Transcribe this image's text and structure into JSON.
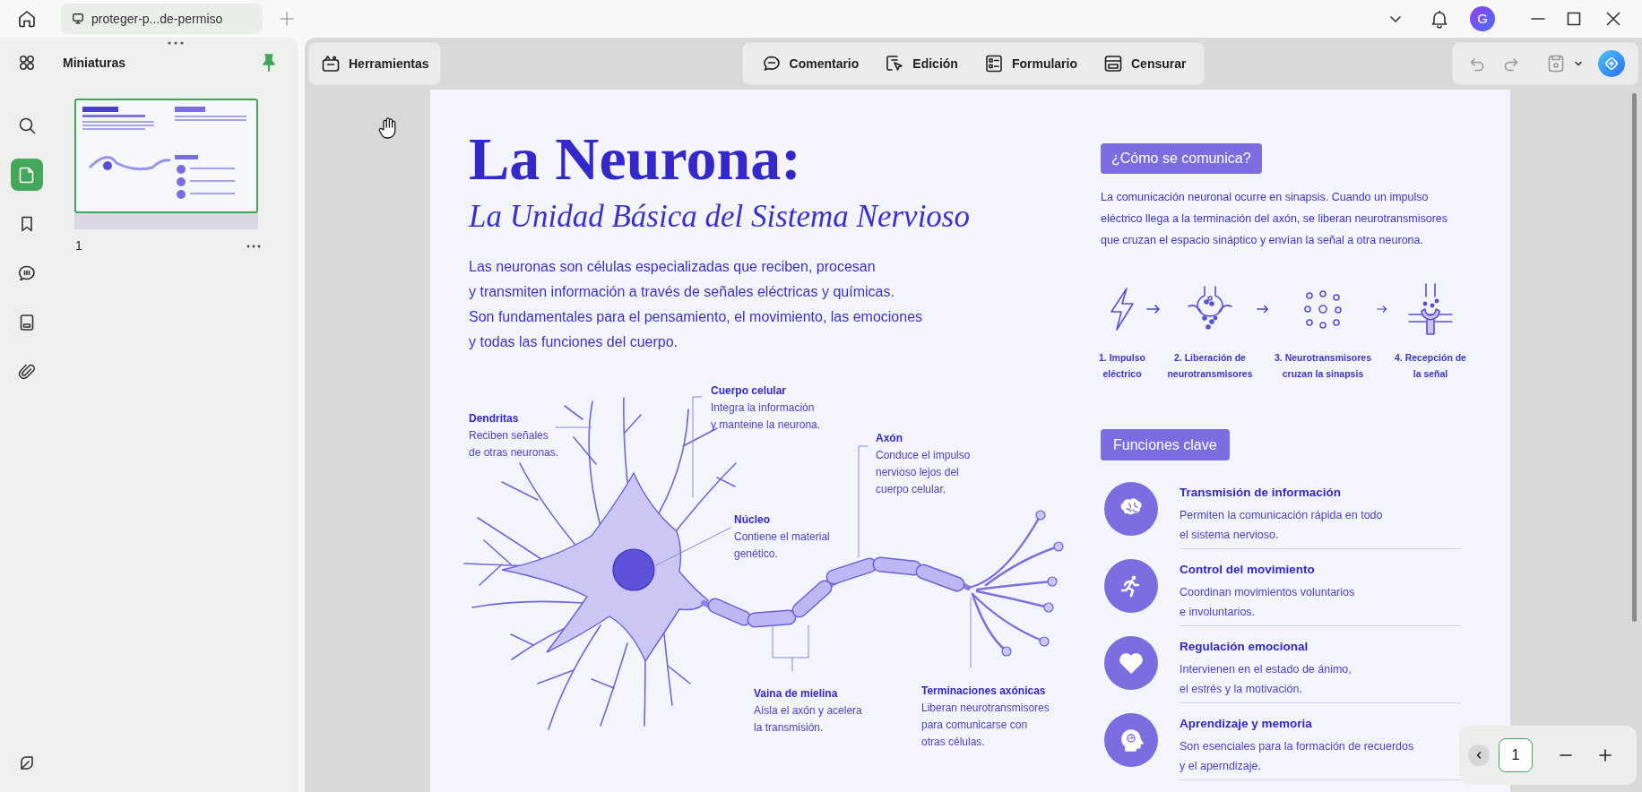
{
  "tab": {
    "title": "proteger-p...de-permiso"
  },
  "avatar": {
    "initial": "G"
  },
  "sidebar": {
    "items": [
      {
        "kind": "grid",
        "selected": false
      },
      {
        "kind": "search",
        "selected": false
      },
      {
        "kind": "page",
        "selected": true
      },
      {
        "kind": "bookmark",
        "selected": false
      },
      {
        "kind": "comment",
        "selected": false
      },
      {
        "kind": "form",
        "selected": false
      },
      {
        "kind": "attachment",
        "selected": false
      }
    ]
  },
  "thumbnails_panel": {
    "title": "Miniaturas",
    "pages": [
      {
        "number": "1",
        "selected": true
      }
    ]
  },
  "toolbar": {
    "tools": {
      "label": "Herramientas"
    },
    "modes": [
      {
        "kind": "comment",
        "label": "Comentario"
      },
      {
        "kind": "edit",
        "label": "Edición"
      },
      {
        "kind": "form",
        "label": "Formulario"
      },
      {
        "kind": "redact",
        "label": "Censurar"
      }
    ]
  },
  "document": {
    "title": "La Neurona:",
    "subtitle": "La Unidad Básica del Sistema Nervioso",
    "intro": [
      "Las neuronas son células especializadas que reciben, procesan",
      "y transmiten información a través de señales eléctricas y químicas.",
      "Son fundamentales para el pensamiento, el movimiento, las emociones",
      "y todas las funciones del cuerpo."
    ],
    "diagram_labels": [
      {
        "title": "Dendritas",
        "text": [
          "Reciben señales",
          "de otras neuronas."
        ]
      },
      {
        "title": "Cuerpo celular",
        "text": [
          "Integra la información",
          "y manteine la neurona."
        ]
      },
      {
        "title": "Axón",
        "text": [
          "Conduce el impulso",
          "nervioso lejos del",
          "cuerpo celular."
        ]
      },
      {
        "title": "Núcleo",
        "text": [
          "Contiene el material",
          "genético."
        ]
      },
      {
        "title": "Vaina de mielina",
        "text": [
          "Aísla el axón y acelera",
          "la transmisión."
        ]
      },
      {
        "title": "Terminaciones axónicas",
        "text": [
          "Liberan neurotransmisores",
          "para comunicarse con",
          "otras células."
        ]
      }
    ],
    "communication": {
      "heading": "¿Cómo se comunica?",
      "text": [
        "La comunicación neuronal ocurre en sinapsis. Cuando un impulso",
        "eléctrico llega a la terminación del axón, se liberan neurotransmisores",
        "que cruzan el espacio sináptico y envían la señal a otra neurona."
      ],
      "steps": [
        {
          "kind": "impulse",
          "label": [
            "1. Impulso",
            "eléctrico"
          ]
        },
        {
          "kind": "release",
          "label": [
            "2. Liberación de",
            "neurotransmisores"
          ]
        },
        {
          "kind": "cross",
          "label": [
            "3. Neurotransmisores",
            "cruzan la sinapsis"
          ]
        },
        {
          "kind": "reception",
          "label": [
            "4. Recepción de",
            "la señal"
          ]
        }
      ]
    },
    "functions": {
      "heading": "Funciones clave",
      "items": [
        {
          "kind": "brain",
          "title": "Transmisión de información",
          "text": [
            "Permiten la comunicación rápida en todo",
            "el sistema nervioso."
          ]
        },
        {
          "kind": "runner",
          "title": "Control del movimiento",
          "text": [
            "Coordinan movimientos voluntarios",
            "e involuntarios."
          ]
        },
        {
          "kind": "heart",
          "title": "Regulación emocional",
          "text": [
            "Intervienen en el estado de ánimo,",
            "el estrés y la motivación."
          ]
        },
        {
          "kind": "head",
          "title": "Aprendizaje y memoria",
          "text": [
            "Son esenciales para la formación de recuerdos",
            "y el aperndizaje."
          ]
        }
      ]
    }
  },
  "page_nav": {
    "page": "1"
  }
}
